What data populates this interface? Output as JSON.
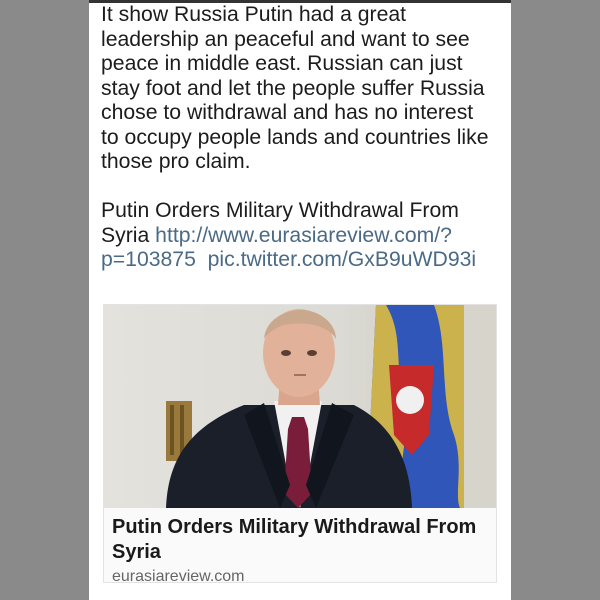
{
  "tweet": {
    "lines": [
      "It show Russia Putin had a great",
      "leadership an peaceful and want to see",
      "peace in middle east. Russian can just",
      "stay foot and let the people suffer Russia",
      "chose to withdrawal and has no interest",
      "to occupy people lands and countries like",
      "those pro claim."
    ],
    "headline_line1": "Putin Orders Military Withdrawal From",
    "headline_line2_text": "Syria",
    "url_part1": "http://www.eurasiareview.com/?",
    "url_part2": "p=103875",
    "pic_link": "pic.twitter.com/GxB9uWD93i"
  },
  "link_card": {
    "title": "Putin Orders Military Withdrawal From Syria",
    "domain": "eurasiareview.com",
    "image": "photo of man in dark suit and burgundy tie in front of flag"
  },
  "colors": {
    "background": "#8a8a8a",
    "card": "#ffffff",
    "link": "#4a6a86",
    "text": "#1c1c1c"
  }
}
